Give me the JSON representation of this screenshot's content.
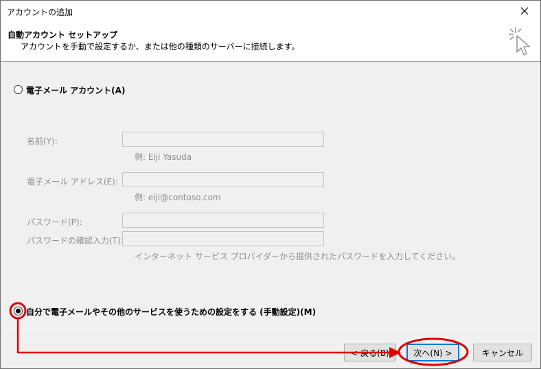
{
  "window": {
    "title": "アカウントの追加",
    "close_icon": "close-icon"
  },
  "header": {
    "title": "自動アカウント セットアップ",
    "description": "アカウントを手動で設定するか、または他の種類のサーバーに接続します。",
    "icon": "cursor-click-icon"
  },
  "email_account_option": {
    "label": "電子メール アカウント(A)",
    "selected": false
  },
  "form": {
    "name": {
      "label": "名前(Y):",
      "value": "",
      "hint": "例: Eiji Yasuda"
    },
    "email": {
      "label": "電子メール アドレス(E):",
      "value": "",
      "hint": "例: eiji@contoso.com"
    },
    "password": {
      "label": "パスワード(P):",
      "value": ""
    },
    "password_confirm": {
      "label": "パスワードの確認入力(T):",
      "value": ""
    },
    "password_hint": "インターネット サービス プロバイダーから提供されたパスワードを入力してください。"
  },
  "manual_option": {
    "label": "自分で電子メールやその他のサービスを使うための設定をする (手動設定)(M)",
    "selected": true
  },
  "buttons": {
    "back": "< 戻る(B)",
    "next": "次へ(N) >",
    "cancel": "キャンセル"
  },
  "annotation_color": "#e00000"
}
